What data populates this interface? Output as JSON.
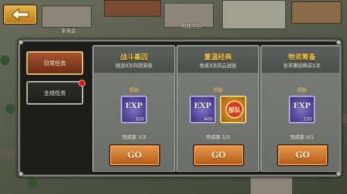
{
  "background": {
    "labels": [
      "軍需處",
      "科技中心"
    ]
  },
  "back_button": {
    "icon": "back-arrow-icon"
  },
  "tabs": [
    {
      "label": "日常任务",
      "active": true
    },
    {
      "label": "主线任务",
      "active": false,
      "has_notification": true
    }
  ],
  "quests": [
    {
      "title": "战斗基因",
      "description": "挑战3次兵团竞技",
      "reward_label": "奖励",
      "rewards": [
        {
          "type": "exp",
          "label": "EXP",
          "qty": "300"
        }
      ],
      "progress": "完成度 1/3",
      "button": "GO"
    },
    {
      "title": "重温经典",
      "description": "完成3次风云战役",
      "reward_label": "奖励",
      "rewards": [
        {
          "type": "exp",
          "label": "EXP",
          "qty": "400"
        },
        {
          "type": "token",
          "label": "部队",
          "qty": "1"
        }
      ],
      "progress": "完成度 1/3",
      "button": "GO"
    },
    {
      "title": "物资筹备",
      "description": "在军需站购买1次",
      "reward_label": "奖励",
      "rewards": [
        {
          "type": "exp",
          "label": "EXP",
          "qty": "200"
        }
      ],
      "progress": "完成度 0/1",
      "button": "GO"
    }
  ],
  "colors": {
    "title": "#f4c94a",
    "go_button": "#d07a30",
    "active_tab": "#8c3f20"
  }
}
